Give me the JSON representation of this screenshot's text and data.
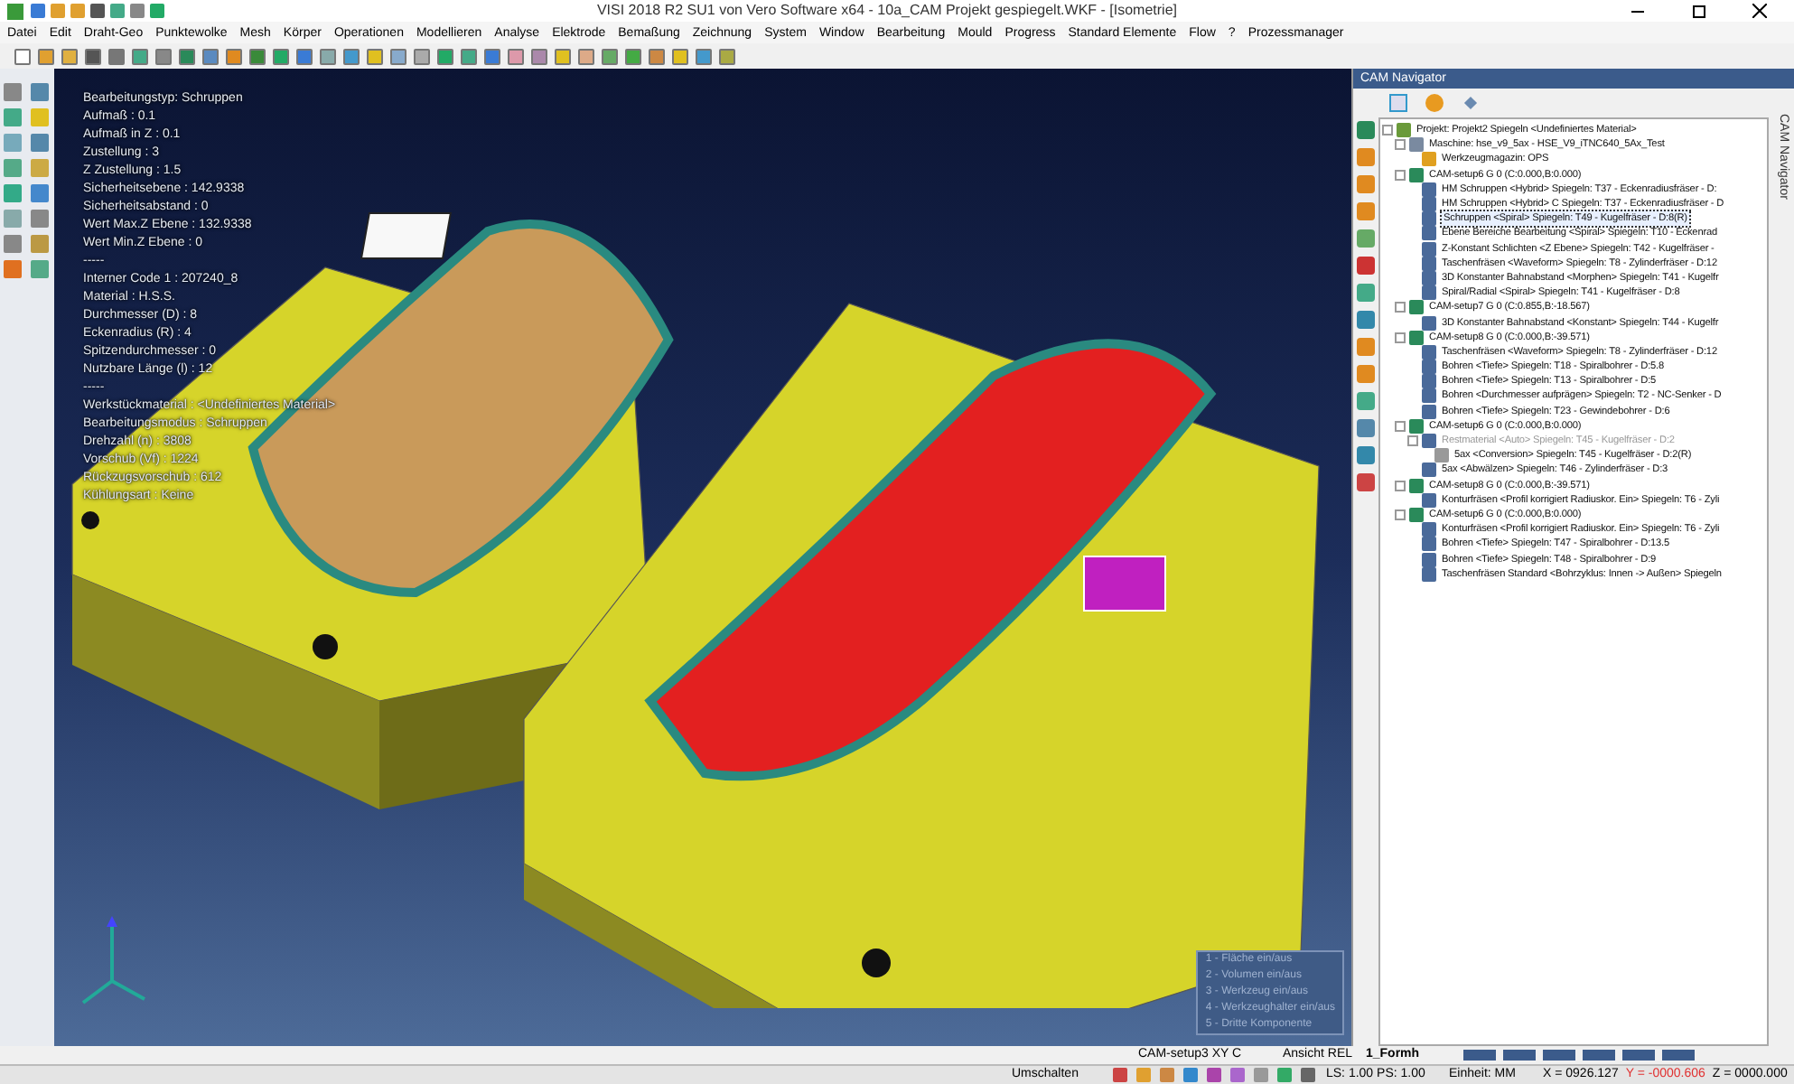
{
  "window": {
    "title": "VISI 2018 R2 SU1 von Vero Software x64 - 10a_CAM Projekt gespiegelt.WKF - [Isometrie]"
  },
  "menu": [
    "Datei",
    "Edit",
    "Draht-Geo",
    "Punktewolke",
    "Mesh",
    "Körper",
    "Operationen",
    "Modellieren",
    "Analyse",
    "Elektrode",
    "Bemaßung",
    "Zeichnung",
    "System",
    "Window",
    "Bearbeitung",
    "Mould",
    "Progress",
    "Standard Elemente",
    "Flow",
    "?",
    "Prozessmanager"
  ],
  "info_lines": [
    "Bearbeitungstyp: Schruppen",
    "Aufmaß : 0.1",
    "Aufmaß in Z : 0.1",
    "Zustellung : 3",
    "Z Zustellung : 1.5",
    "Sicherheitsebene : 142.9338",
    "Sicherheitsabstand : 0",
    "Wert Max.Z Ebene : 132.9338",
    "Wert Min.Z Ebene : 0",
    "-----",
    "Interner Code 1 : 207240_8",
    "Material : H.S.S.",
    "Durchmesser (D) : 8",
    "Eckenradius (R) : 4",
    "Spitzendurchmesser : 0",
    "Nutzbare Länge (l) : 12",
    "-----",
    "Werkstückmaterial : <Undefiniertes Material>",
    "Bearbeitungsmodus : Schruppen",
    "Drehzahl (n) : 3808",
    "Vorschub (Vf) : 1224",
    "Rückzugsvorschub : 612",
    "Kühlungsart : Keine"
  ],
  "legend": [
    "1 - Fläche ein/aus",
    "2 - Volumen ein/aus",
    "3 - Werkzeug ein/aus",
    "4 - Werkzeughalter ein/aus",
    "5 - Dritte Komponente"
  ],
  "navigator": {
    "title": "CAM Navigator",
    "side_label": "CAM Navigator",
    "tree": [
      {
        "kind": "project",
        "label": "Projekt: Projekt2 Spiegeln <Undefiniertes Material>",
        "expanded": true,
        "selected": false,
        "disabled": false,
        "children": [
          {
            "kind": "machine",
            "label": "Maschine: hse_v9_5ax - HSE_V9_iTNC640_5Ax_Test",
            "expanded": true,
            "selected": false,
            "disabled": false,
            "children": [
              {
                "kind": "magazine",
                "label": "Werkzeugmagazin: OPS",
                "selected": false,
                "disabled": false
              }
            ]
          },
          {
            "kind": "setup",
            "label": "CAM-setup6 G 0 (C:0.000,B:0.000)",
            "expanded": true,
            "selected": false,
            "disabled": false,
            "children": [
              {
                "kind": "op",
                "label": "HM Schruppen <Hybrid>  Spiegeln: T37 - Eckenradiusfräser - D:",
                "selected": false,
                "disabled": false
              },
              {
                "kind": "op",
                "label": "HM Schruppen <Hybrid> C  Spiegeln: T37 - Eckenradiusfräser - D",
                "selected": false,
                "disabled": false
              },
              {
                "kind": "op",
                "label": "Schruppen <Spiral>  Spiegeln: T49 - Kugelfräser - D:8(R)",
                "selected": true,
                "disabled": false
              },
              {
                "kind": "op",
                "label": "Ebene Bereiche Bearbeitung <Spiral>  Spiegeln: T10 - Eckenrad",
                "selected": false,
                "disabled": false
              },
              {
                "kind": "op",
                "label": "Z-Konstant Schlichten <Z Ebene>  Spiegeln: T42 - Kugelfräser -",
                "selected": false,
                "disabled": false
              },
              {
                "kind": "op",
                "label": "Taschenfräsen <Waveform>  Spiegeln: T8 - Zylinderfräser - D:12",
                "selected": false,
                "disabled": false
              },
              {
                "kind": "op",
                "label": "3D Konstanter Bahnabstand <Morphen>  Spiegeln: T41 - Kugelfr",
                "selected": false,
                "disabled": false
              },
              {
                "kind": "op",
                "label": "Spiral/Radial <Spiral>  Spiegeln: T41 - Kugelfräser - D:8",
                "selected": false,
                "disabled": false
              }
            ]
          },
          {
            "kind": "setup",
            "label": "CAM-setup7 G 0 (C:0.855,B:-18.567)",
            "expanded": true,
            "selected": false,
            "disabled": false,
            "children": [
              {
                "kind": "op",
                "label": "3D Konstanter Bahnabstand <Konstant>  Spiegeln: T44 - Kugelfr",
                "selected": false,
                "disabled": false
              }
            ]
          },
          {
            "kind": "setup",
            "label": "CAM-setup8 G 0 (C:0.000,B:-39.571)",
            "expanded": true,
            "selected": false,
            "disabled": false,
            "children": [
              {
                "kind": "op",
                "label": "Taschenfräsen <Waveform>  Spiegeln: T8 - Zylinderfräser - D:12",
                "selected": false,
                "disabled": false
              },
              {
                "kind": "op",
                "label": "Bohren <Tiefe>  Spiegeln: T18 - Spiralbohrer - D:5.8",
                "selected": false,
                "disabled": false
              },
              {
                "kind": "op",
                "label": "Bohren <Tiefe>  Spiegeln: T13 - Spiralbohrer - D:5",
                "selected": false,
                "disabled": false
              },
              {
                "kind": "op",
                "label": "Bohren <Durchmesser aufprägen>  Spiegeln: T2 - NC-Senker - D",
                "selected": false,
                "disabled": false
              },
              {
                "kind": "op",
                "label": "Bohren <Tiefe>  Spiegeln: T23 - Gewindebohrer - D:6",
                "selected": false,
                "disabled": false
              }
            ]
          },
          {
            "kind": "setup",
            "label": "CAM-setup6 G 0 (C:0.000,B:0.000)",
            "expanded": true,
            "selected": false,
            "disabled": false,
            "children": [
              {
                "kind": "op",
                "label": "Restmaterial <Auto>  Spiegeln: T45 - Kugelfräser - D:2",
                "expanded": true,
                "selected": false,
                "disabled": true,
                "children": [
                  {
                    "kind": "op5",
                    "label": "5ax <Conversion>  Spiegeln: T45 - Kugelfräser - D:2(R)",
                    "selected": false,
                    "disabled": false
                  }
                ]
              },
              {
                "kind": "op",
                "label": "5ax <Abwälzen>  Spiegeln: T46 - Zylinderfräser - D:3",
                "selected": false,
                "disabled": false
              }
            ]
          },
          {
            "kind": "setup",
            "label": "CAM-setup8 G 0 (C:0.000,B:-39.571)",
            "expanded": true,
            "selected": false,
            "disabled": false,
            "children": [
              {
                "kind": "op",
                "label": "Konturfräsen <Profil korrigiert Radiuskor. Ein>  Spiegeln: T6 - Zyli",
                "selected": false,
                "disabled": false
              }
            ]
          },
          {
            "kind": "setup",
            "label": "CAM-setup6 G 0 (C:0.000,B:0.000)",
            "expanded": true,
            "selected": false,
            "disabled": false,
            "children": [
              {
                "kind": "op",
                "label": "Konturfräsen <Profil korrigiert Radiuskor. Ein>  Spiegeln: T6 - Zyli",
                "selected": false,
                "disabled": false
              },
              {
                "kind": "op",
                "label": "Bohren <Tiefe>  Spiegeln: T47 - Spiralbohrer - D:13.5",
                "selected": false,
                "disabled": false
              },
              {
                "kind": "op",
                "label": "Bohren <Tiefe>  Spiegeln: T48 - Spiralbohrer - D:9",
                "selected": false,
                "disabled": false
              },
              {
                "kind": "op",
                "label": "Taschenfräsen Standard <Bohrzyklus: Innen -> Außen>  Spiegeln",
                "selected": false,
                "disabled": false
              }
            ]
          }
        ]
      }
    ]
  },
  "info_row": {
    "setup": "CAM-setup3 XY C",
    "view": "Ansicht REL",
    "layer": "1_Formh"
  },
  "status_bar": {
    "mode": "Umschalten",
    "scale": "LS: 1.00 PS: 1.00",
    "unit": "Einheit: MM",
    "x": "X = 0926.127",
    "y": "Y = -0000.606",
    "z": "Z = 0000.000"
  }
}
